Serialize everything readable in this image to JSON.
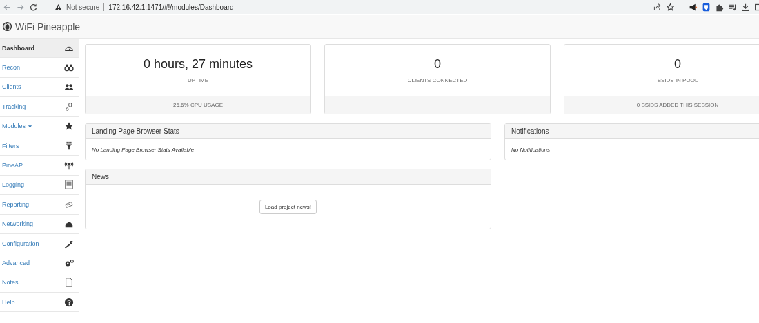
{
  "browser": {
    "security": "Not secure",
    "url": "172.16.42.1:1471/#!/modules/Dashboard"
  },
  "brand": "WiFi Pineapple",
  "sidebar": {
    "items": [
      {
        "label": "Dashboard",
        "selected": true
      },
      {
        "label": "Recon",
        "selected": false
      },
      {
        "label": "Clients",
        "selected": false
      },
      {
        "label": "Tracking",
        "selected": false
      },
      {
        "label": "Modules",
        "selected": false,
        "caret": true
      },
      {
        "label": "Filters",
        "selected": false
      },
      {
        "label": "PineAP",
        "selected": false
      },
      {
        "label": "Logging",
        "selected": false
      },
      {
        "label": "Reporting",
        "selected": false
      },
      {
        "label": "Networking",
        "selected": false
      },
      {
        "label": "Configuration",
        "selected": false
      },
      {
        "label": "Advanced",
        "selected": false
      },
      {
        "label": "Notes",
        "selected": false
      },
      {
        "label": "Help",
        "selected": false
      }
    ]
  },
  "stats": [
    {
      "value": "0 hours, 27 minutes",
      "label": "UPTIME",
      "footer": "26.6% CPU USAGE"
    },
    {
      "value": "0",
      "label": "CLIENTS CONNECTED"
    },
    {
      "value": "0",
      "label": "SSIDS IN POOL",
      "footer": "0 SSIDS ADDED THIS SESSION"
    }
  ],
  "landing_panel": {
    "title": "Landing Page Browser Stats",
    "message": "No Landing Page Browser Stats Available"
  },
  "notifications_panel": {
    "title": "Notifications",
    "message": "No Notifications"
  },
  "news_panel": {
    "title": "News",
    "button": "Load project news!"
  }
}
